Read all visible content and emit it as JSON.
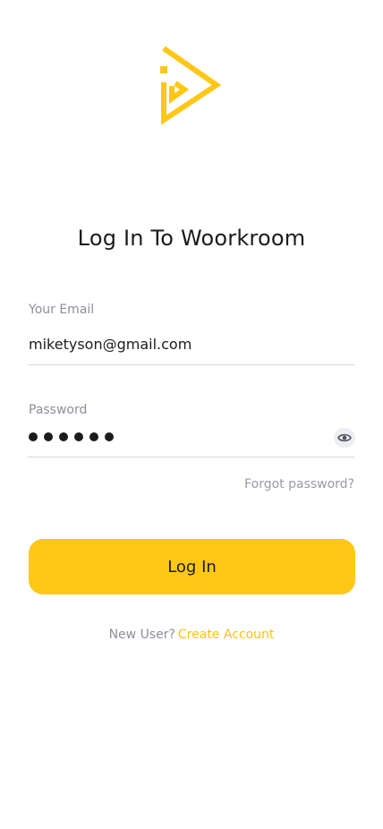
{
  "app": {
    "logo_icon": "woorkroom-logo-icon",
    "brand_color": "#FFC716",
    "title": "Log In To Woorkroom"
  },
  "form": {
    "email": {
      "label": "Your Email",
      "value": "miketyson@gmail.com"
    },
    "password": {
      "label": "Password",
      "masked_length": 6,
      "toggle_icon": "eye-icon"
    },
    "forgot_password": "Forgot password?",
    "submit_label": "Log In"
  },
  "footer": {
    "new_user_text": "New User?",
    "create_account_link": "Create Account"
  }
}
